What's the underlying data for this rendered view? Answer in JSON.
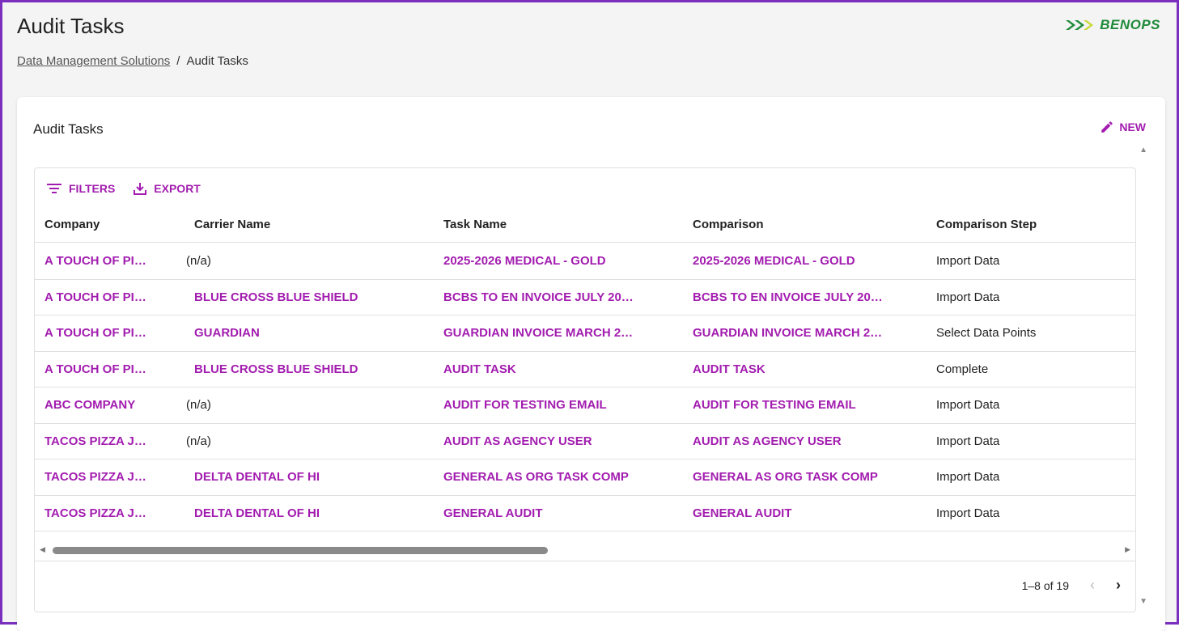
{
  "header": {
    "title": "Audit Tasks",
    "logo_text": "BENOPS"
  },
  "breadcrumb": {
    "parent": "Data Management Solutions",
    "separator": "/",
    "current": "Audit Tasks"
  },
  "card": {
    "title": "Audit Tasks",
    "new_label": "NEW"
  },
  "toolbar": {
    "filters_label": "FILTERS",
    "export_label": "EXPORT"
  },
  "table": {
    "columns": [
      "Company",
      "Carrier Name",
      "Task Name",
      "Comparison",
      "Comparison Step"
    ],
    "rows": [
      {
        "company": "A TOUCH OF PI…",
        "carrier": "(n/a)",
        "task": "2025-2026 MEDICAL - GOLD",
        "comparison": "2025-2026 MEDICAL - GOLD",
        "step": "Import Data"
      },
      {
        "company": "A TOUCH OF PI…",
        "carrier": "BLUE CROSS BLUE SHIELD",
        "task": "BCBS TO EN INVOICE JULY 20…",
        "comparison": "BCBS TO EN INVOICE JULY 20…",
        "step": "Import Data"
      },
      {
        "company": "A TOUCH OF PI…",
        "carrier": "GUARDIAN",
        "task": "GUARDIAN INVOICE MARCH 2…",
        "comparison": "GUARDIAN INVOICE MARCH 2…",
        "step": "Select Data Points"
      },
      {
        "company": "A TOUCH OF PI…",
        "carrier": "BLUE CROSS BLUE SHIELD",
        "task": "AUDIT TASK",
        "comparison": "AUDIT TASK",
        "step": "Complete"
      },
      {
        "company": "ABC COMPANY",
        "carrier": "(n/a)",
        "task": "AUDIT FOR TESTING EMAIL",
        "comparison": "AUDIT FOR TESTING EMAIL",
        "step": "Import Data"
      },
      {
        "company": "TACOS PIZZA J…",
        "carrier": "(n/a)",
        "task": "AUDIT AS AGENCY USER",
        "comparison": "AUDIT AS AGENCY USER",
        "step": "Import Data"
      },
      {
        "company": "TACOS PIZZA J…",
        "carrier": "DELTA DENTAL OF HI",
        "task": "GENERAL AS ORG TASK COMP",
        "comparison": "GENERAL AS ORG TASK COMP",
        "step": "Import Data"
      },
      {
        "company": "TACOS PIZZA J…",
        "carrier": "DELTA DENTAL OF HI",
        "task": "GENERAL AUDIT",
        "comparison": "GENERAL AUDIT",
        "step": "Import Data"
      }
    ]
  },
  "pagination": {
    "range_label": "1–8 of 19"
  },
  "colors": {
    "accent": "#a21caf",
    "frame": "#7b2fbe",
    "logo": "#1f8a3a"
  }
}
